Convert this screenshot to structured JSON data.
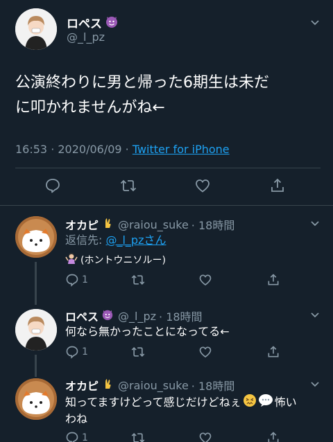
{
  "main": {
    "display_name": "ロペス",
    "handle": "@_l_pz",
    "text_line1": "公演終わりに男と帰った6期生は未だ",
    "text_line2": "に叩かれませんがね←",
    "time": "16:53 · 2020/06/09 · ",
    "source": "Twitter for iPhone"
  },
  "replies": [
    {
      "name": "オカピ",
      "handle": "@raiou_suke",
      "time": "· 18時間",
      "reply_to_label": "返信先: ",
      "reply_to_link": "@_l_pzさん",
      "text": "(ホントウニソルー)",
      "reply_count": "1"
    },
    {
      "name": "ロペス",
      "handle": "@_l_pz",
      "time": "· 18時間",
      "text": "何なら無かったことになってる←",
      "reply_count": "1"
    },
    {
      "name": "オカピ",
      "handle": "@raiou_suke",
      "time": "· 18時間",
      "text_line1": "知ってますけどって感じだけどねぇ",
      "text_line1b": "怖い",
      "text_line2": "わね",
      "reply_count": "1"
    }
  ],
  "colors": {
    "background": "#15202b",
    "accent": "#1da1f2",
    "muted": "#8899a6",
    "divider": "#38444d"
  }
}
